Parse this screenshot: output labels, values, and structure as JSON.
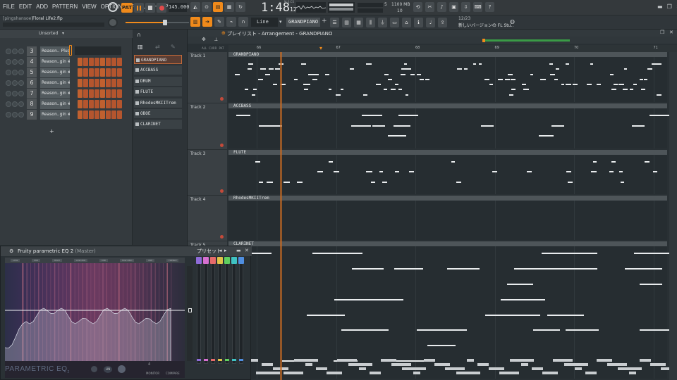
{
  "menu": [
    "FILE",
    "EDIT",
    "ADD",
    "PATTERN",
    "VIEW",
    "OPTIONS",
    "TOOLS",
    "HELP"
  ],
  "transport": {
    "mode": "PAT",
    "tempo": "145.000",
    "time": "1:48",
    "time_ms": "12",
    "time_sub": "M:S:CS",
    "mem": "1100 MB",
    "voices": "10",
    "cpu": "5"
  },
  "project": {
    "user": "[pingshansoe]",
    "file": "Floral Life2.flp"
  },
  "snap": {
    "value": "Line"
  },
  "pattern_selector": {
    "value": "GRANDPIANO"
  },
  "news": {
    "date": "12/23",
    "text": "新しいバージョンの FL Stu.."
  },
  "rack": {
    "filter": "Unsorted",
    "channels": [
      {
        "num": "3",
        "name": "Reason.. Plugin"
      },
      {
        "num": "4",
        "name": "Reason..gin #2"
      },
      {
        "num": "5",
        "name": "Reason..gin #3"
      },
      {
        "num": "6",
        "name": "Reason..gin #4"
      },
      {
        "num": "7",
        "name": "Reason..gin #5"
      },
      {
        "num": "8",
        "name": "Reason..gin #6"
      },
      {
        "num": "9",
        "name": "Reason..gin #7"
      }
    ],
    "add_label": "+"
  },
  "browser": {
    "patterns": [
      "GRANDPIANO",
      "ACCBASS",
      "DRUM",
      "FLUTE",
      "RhodesMKIITrem",
      "OBOE",
      "CLARINET"
    ],
    "tabs": [
      "ALL",
      "CURR",
      "PAT"
    ]
  },
  "playlist": {
    "title": "プレイリスト - Arrangement - GRANDPIANO",
    "bars": [
      "66",
      "67",
      "68",
      "69",
      "70",
      "71"
    ],
    "tracks": [
      {
        "label": "Track 1",
        "clip": "GRANDPIANO"
      },
      {
        "label": "Track 2",
        "clip": "ACCBASS"
      },
      {
        "label": "Track 3",
        "clip": "FLUTE"
      },
      {
        "label": "Track 4",
        "clip": "RhodesMKIITrem"
      },
      {
        "label": "Track 5",
        "clip": "CLARINET"
      }
    ]
  },
  "eq": {
    "title": "Fruity parametric EQ 2",
    "target": "(Master)",
    "preset_label": "プリセット",
    "brand": "PARAMETRIC EQ",
    "brand_sub": "2",
    "band_labels": [
      "LOW",
      "MID",
      "HIGH",
      "LOW MID",
      "MID",
      "HIGH MID",
      "PRE",
      "TREBLE"
    ],
    "footer": [
      "LIN",
      "MONITOR",
      "COMPARE"
    ],
    "order_label": "4",
    "band_colors": [
      "#8e6bd8",
      "#d66fd0",
      "#e56a6a",
      "#e0c24a",
      "#5fcf5f",
      "#3fc2c2",
      "#4f8ee0"
    ]
  }
}
